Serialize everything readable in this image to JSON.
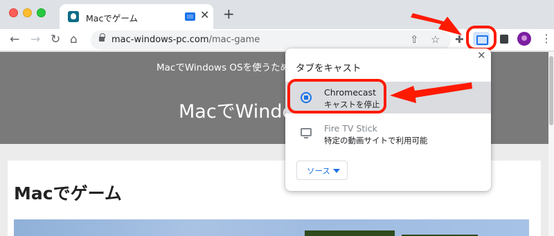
{
  "tab": {
    "title": "Macでゲーム",
    "favicon_icon": "site-favicon-icon",
    "cast_indicator_icon": "tab-casting-icon"
  },
  "toolbar": {
    "url_domain": "mac-windows-pc.com",
    "url_path": "/mac-game",
    "icons": [
      "back-arrow-icon",
      "forward-arrow-icon",
      "reload-icon",
      "home-icon",
      "share-icon",
      "bookmark-star-icon",
      "extensions-puzzle-icon",
      "cast-icon",
      "side-panel-icon",
      "profile-avatar-icon",
      "menu-dots-icon"
    ]
  },
  "page": {
    "hero_subtitle": "MacでWindows OSを使うため",
    "hero_title": "MacでWindo",
    "article_title": "Macでゲーム"
  },
  "cast_popup": {
    "title": "タブをキャスト",
    "devices": [
      {
        "name": "Chromecast",
        "status": "キャストを停止",
        "icon": "stop-casting-icon",
        "active": true
      },
      {
        "name": "Fire TV Stick",
        "status": "特定の動画サイトで利用可能",
        "icon": "tv-icon",
        "active": false
      }
    ],
    "source_label": "ソース"
  },
  "annotations": {
    "highlight_color": "#ff1a00"
  },
  "colors": {
    "accent": "#1a73e8",
    "hero_bg": "#7a7a7a"
  }
}
